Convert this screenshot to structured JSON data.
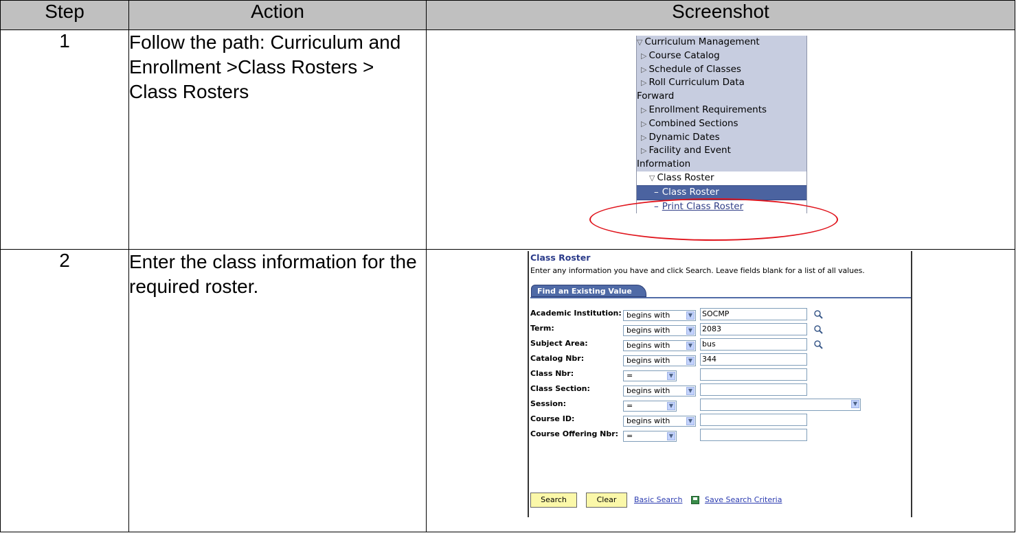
{
  "table": {
    "headers": {
      "step": "Step",
      "action": "Action",
      "screenshot": "Screenshot"
    },
    "rows": [
      {
        "step": "1",
        "action": "Follow the path: Curriculum and Enrollment >Class Rosters > Class Rosters"
      },
      {
        "step": "2",
        "action": "Enter the class information for the required roster."
      }
    ]
  },
  "menu": {
    "root": "Curriculum Management",
    "items": [
      "Course Catalog",
      "Schedule of Classes",
      "Roll Curriculum Data",
      "Forward",
      "Enrollment Requirements",
      "Combined Sections",
      "Dynamic Dates",
      "Facility and Event",
      "Information"
    ],
    "class_roster_folder": "Class Roster",
    "selected": "Class Roster",
    "print_link": "Print Class Roster",
    "highlight_color": "#e0141c"
  },
  "search": {
    "title": "Class Roster",
    "instruction": "Enter any information you have and click Search. Leave fields blank for a list of all values.",
    "tab": "Find an Existing Value",
    "fields": [
      {
        "label": "Academic Institution:",
        "op": "begins with",
        "value": "SOCMP",
        "lookup": true
      },
      {
        "label": "Term:",
        "op": "begins with",
        "value": "2083",
        "lookup": true
      },
      {
        "label": "Subject Area:",
        "op": "begins with",
        "value": "bus",
        "lookup": true
      },
      {
        "label": "Catalog Nbr:",
        "op": "begins with",
        "value": "344",
        "lookup": false
      },
      {
        "label": "Class Nbr:",
        "op": "=",
        "value": "",
        "lookup": false
      },
      {
        "label": "Class Section:",
        "op": "begins with",
        "value": "",
        "lookup": false
      },
      {
        "label": "Session:",
        "op": "=",
        "value": "",
        "lookup": false
      },
      {
        "label": "Course ID:",
        "op": "begins with",
        "value": "",
        "lookup": false
      },
      {
        "label": "Course Offering Nbr:",
        "op": "=",
        "value": "",
        "lookup": false
      }
    ],
    "buttons": {
      "search": "Search",
      "clear": "Clear"
    },
    "links": {
      "basic": "Basic Search",
      "save": "Save Search Criteria"
    }
  }
}
